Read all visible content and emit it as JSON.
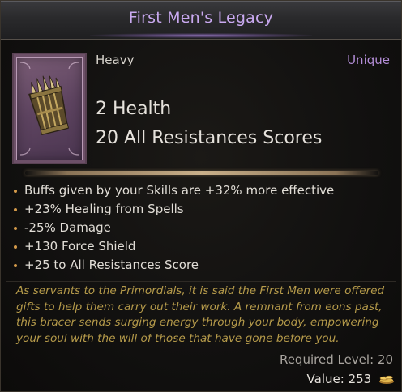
{
  "item": {
    "name": "First Men's Legacy",
    "type": "Heavy",
    "rarity": "Unique",
    "implicits": [
      "2 Health",
      "20 All Resistances Scores"
    ],
    "affixes": [
      "Buffs given by your Skills are +32% more effective",
      "+23% Healing from Spells",
      "-25% Damage",
      "+130 Force Shield",
      "+25 to All Resistances Score"
    ],
    "lore": "As servants to the Primordials, it is said the First Men were offered\ngifts to help them carry out their work. A remnant from eons past,\nthis bracer sends surging energy through your body, empowering\nyour soul with the will of those that have gone before you.",
    "required_level_text": "Required Level: 20",
    "value_label": "Value:",
    "value": "253",
    "icon": "bracer-icon",
    "currency_icon": "gold-coins-icon"
  },
  "colors": {
    "title": "#c9a9f0",
    "rarity": "#b48ed8",
    "lore": "#b59a4a",
    "bullet": "#d49a4a"
  }
}
